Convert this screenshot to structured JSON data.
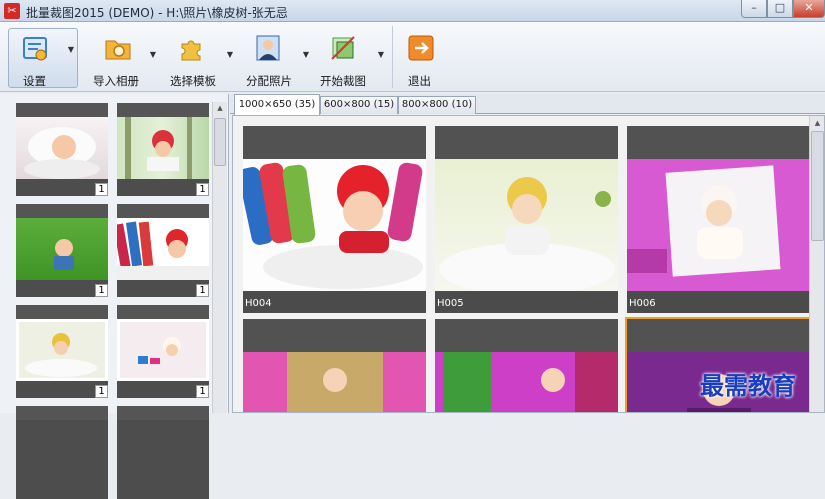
{
  "window": {
    "title": "批量裁图2015 (DEMO) - H:\\照片\\橡皮树-张无忌",
    "min_symbol": "–",
    "max_symbol": "□",
    "close_symbol": "✕"
  },
  "toolbar": {
    "settings_label": "设置",
    "import_label": "导入相册",
    "template_label": "选择模板",
    "assign_label": "分配照片",
    "crop_label": "开始裁图",
    "exit_label": "退出",
    "dropdown_arrow": "▼",
    "colors": {
      "settings": "#3a7fc8",
      "import": "#e29a1a",
      "template": "#e8b52a",
      "assign": "#3664a8",
      "crop": "#4f9e3a",
      "exit": "#e87820"
    }
  },
  "left_panel": {
    "thumbnails": [
      {
        "count": "1",
        "icon": "baby-photo"
      },
      {
        "count": "1",
        "icon": "baby-photo"
      },
      {
        "count": "1",
        "icon": "baby-photo"
      },
      {
        "count": "1",
        "icon": "baby-photo"
      },
      {
        "count": "1",
        "icon": "baby-photo"
      },
      {
        "count": "1",
        "icon": "baby-photo"
      }
    ]
  },
  "tabs": [
    {
      "label": "1000×650 (35)"
    },
    {
      "label": "600×800 (15)"
    },
    {
      "label": "800×800 (10)"
    }
  ],
  "grid": {
    "cards": [
      {
        "label": "H004"
      },
      {
        "label": "H005"
      },
      {
        "label": "H006"
      },
      {
        "label": ""
      },
      {
        "label": ""
      },
      {
        "label": ""
      }
    ],
    "selected_border_color": "#f0a020"
  },
  "watermark": {
    "text": "最需教育"
  }
}
